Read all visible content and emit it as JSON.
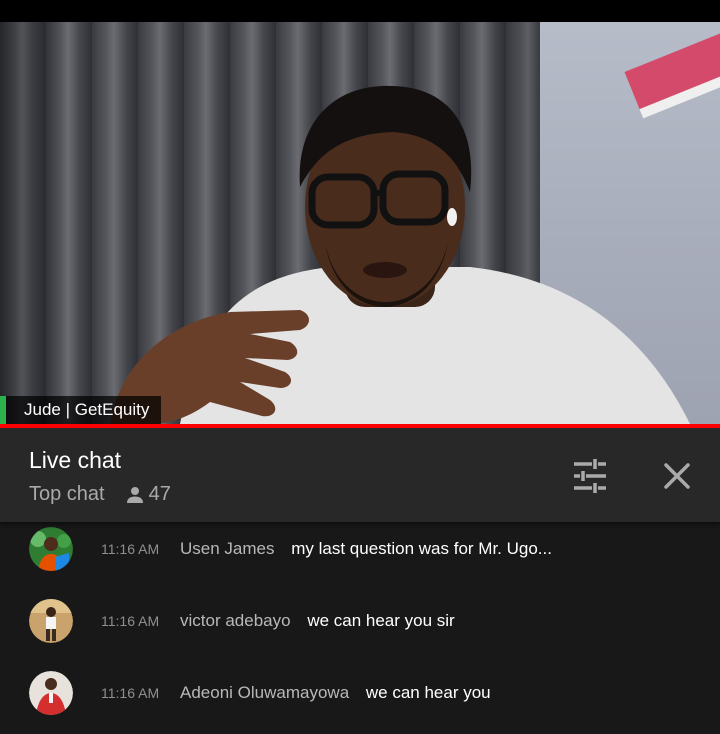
{
  "video": {
    "speaker_label": "Jude | GetEquity"
  },
  "chat": {
    "title": "Live chat",
    "mode": "Top chat",
    "viewer_count": "47",
    "icons": {
      "viewers": "person-icon",
      "filter": "tune-icon",
      "close": "close-icon"
    }
  },
  "messages": [
    {
      "time": "11:16 AM",
      "author": "Usen James",
      "text": "my last question was for Mr. Ugo..."
    },
    {
      "time": "11:16 AM",
      "author": "victor adebayo",
      "text": "we can hear you sir"
    },
    {
      "time": "11:16 AM",
      "author": "Adeoni Oluwamayowa",
      "text": "we can hear you"
    }
  ],
  "colors": {
    "accent": "#ff0000",
    "panel": "#282828",
    "background": "#181818",
    "live_indicator": "#2bb24c"
  }
}
